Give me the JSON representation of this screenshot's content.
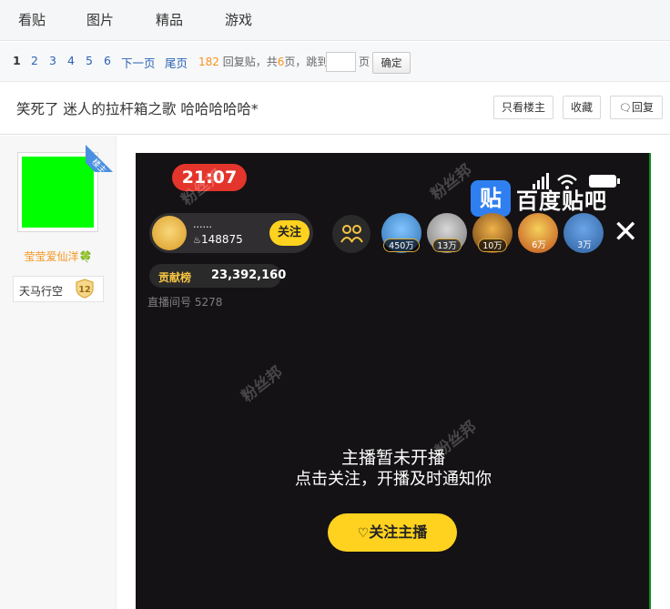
{
  "nav": {
    "tabs": [
      "看贴",
      "图片",
      "精品",
      "游戏"
    ]
  },
  "pager": {
    "current": "1",
    "pages": [
      "2",
      "3",
      "4",
      "5",
      "6"
    ],
    "next_label": "下一页",
    "last_label": "尾页",
    "reply_count": "182",
    "reply_suffix": "回复贴，共",
    "page_total": "6",
    "page_suffix": "页，跳到",
    "jump_unit": "页",
    "confirm_label": "确定"
  },
  "thread": {
    "title": "笑死了 迷人的拉杆箱之歌 哈哈哈哈哈*",
    "only_op_label": "只看楼主",
    "favorite_label": "收藏",
    "reply_label": "回复"
  },
  "author": {
    "ribbon": "楼主",
    "username": "莹莹爱仙洋",
    "clover": "🍀",
    "badge_text": "天马行空",
    "level": "12"
  },
  "post_image": {
    "time": "21:07",
    "watermark": "粉丝邦",
    "tieba_logo": "贴",
    "tieba_text": "百度贴吧",
    "host_name": "......",
    "host_count": "148875",
    "follow_label": "关注",
    "fan_counts": [
      "450万",
      "13万",
      "10万",
      "6万",
      "3万"
    ],
    "close_glyph": "✕",
    "contrib_label": "贡献榜",
    "contrib_value": "23,392,160",
    "room_no": "直播间号 5278",
    "offline_line1": "主播暂未开播",
    "offline_line2": "点击关注，开播及时通知你",
    "follow_host_label": "关注主播"
  },
  "colors": {
    "link": "#2d64b3",
    "highlight": "#f7941d",
    "avatar": "#00ff00",
    "live_yellow": "#ffd21f",
    "time_red": "#e3352b"
  }
}
